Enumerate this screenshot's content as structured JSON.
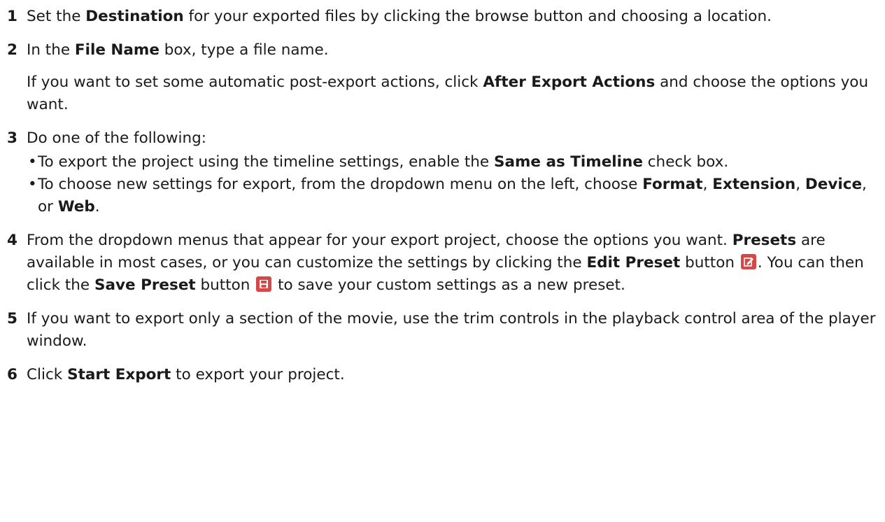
{
  "steps": [
    {
      "number": "1",
      "text": {
        "a": "Set the ",
        "b": "Destination",
        "c": " for your exported files by clicking the browse button and choosing a location."
      }
    },
    {
      "number": "2",
      "text": {
        "a": "In the ",
        "b": "File Name",
        "c": " box, type a file name."
      },
      "sub": {
        "a": "If you want to set some automatic post-export actions, click ",
        "b": "After Export Actions",
        "c": " and choose the options you want."
      }
    },
    {
      "number": "3",
      "text": {
        "a": "Do one of the following:"
      },
      "bullets": [
        {
          "a": "To export the project using the timeline settings, enable the ",
          "b": "Same as Timeline",
          "c": " check box."
        },
        {
          "a": "To choose new settings for export, from the dropdown menu on the left, choose ",
          "b": "Format",
          "c": ", ",
          "d": "Extension",
          "e": ", ",
          "f": "Device",
          "g": ", or ",
          "h": "Web",
          "i": "."
        }
      ]
    },
    {
      "number": "4",
      "text": {
        "a": "From the dropdown menus that appear for your export project, choose the options you want. ",
        "b": "Presets",
        "c": " are available in most cases, or you can customize the settings by clicking the ",
        "d": "Edit Preset",
        "e": " button ",
        "f": ". You can then click the ",
        "g": "Save Preset",
        "h": " button ",
        "i": " to save your custom settings as a new preset."
      },
      "icons": {
        "edit": "edit-preset-icon",
        "save": "save-preset-icon",
        "color": "#d64848"
      }
    },
    {
      "number": "5",
      "text": {
        "a": "If you want to export only a section of the movie, use the trim controls in the playback control area of the player window."
      }
    },
    {
      "number": "6",
      "text": {
        "a": "Click ",
        "b": "Start Export",
        "c": " to export your project."
      }
    }
  ]
}
